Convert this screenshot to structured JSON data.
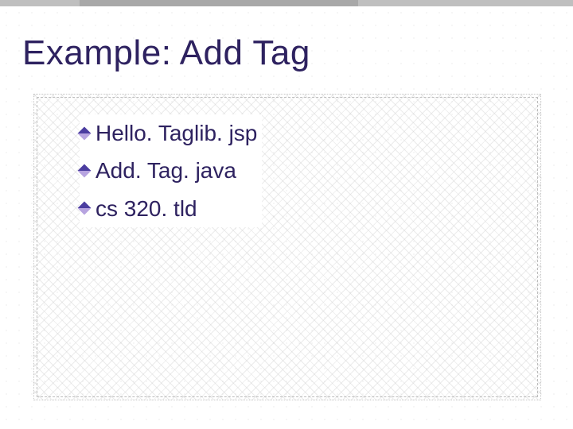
{
  "slide": {
    "title": "Example: Add Tag",
    "bullets": [
      "Hello. Taglib. jsp",
      "Add. Tag. java",
      "cs 320. tld"
    ]
  }
}
